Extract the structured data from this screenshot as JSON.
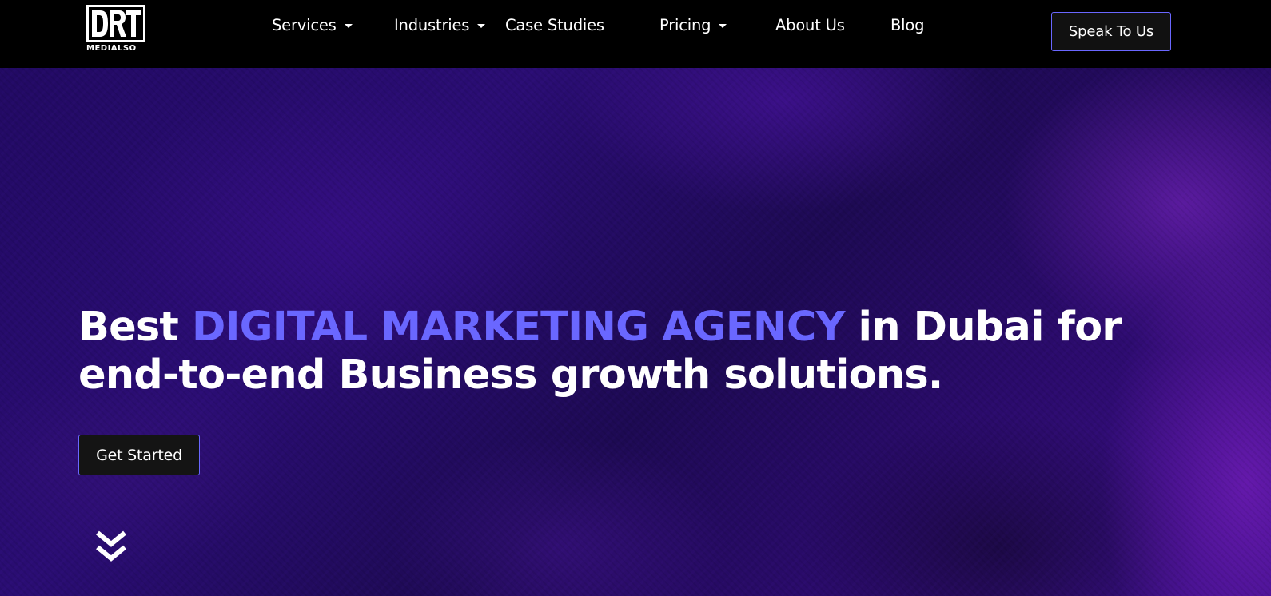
{
  "header": {
    "logo_text": "MEDIALSO",
    "logo_mark": "DRT",
    "nav": [
      {
        "label": "Services",
        "has_dropdown": true
      },
      {
        "label": "Industries",
        "has_dropdown": true
      },
      {
        "label": "Case Studies",
        "has_dropdown": false
      },
      {
        "label": "Pricing",
        "has_dropdown": true
      },
      {
        "label": "About Us",
        "has_dropdown": false
      },
      {
        "label": "Blog",
        "has_dropdown": false
      }
    ],
    "cta_label": "Speak To Us"
  },
  "hero": {
    "headline_prefix": "Best ",
    "headline_accent": "DIGITAL MARKETING AGENCY",
    "headline_suffix_line1": " in Dubai for",
    "headline_line2": "end-to-end Business growth solutions.",
    "cta_label": "Get Started",
    "scroll_icon": "double-chevron-down-icon"
  },
  "colors": {
    "accent": "#6a67ff",
    "header_bg": "#000000",
    "hero_bg": "#2a0d73",
    "button_bg": "#141414"
  }
}
